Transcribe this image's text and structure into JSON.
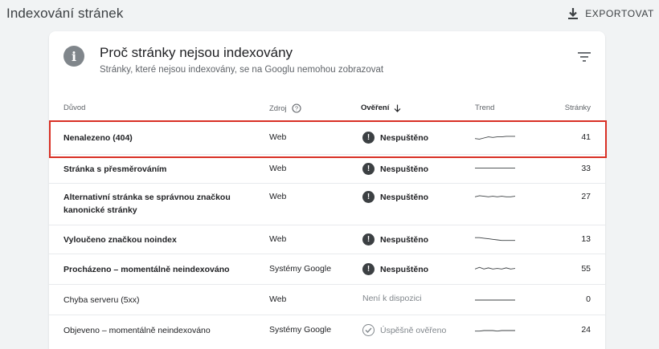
{
  "page": {
    "title": "Indexování stránek",
    "export_label": "EXPORTOVAT"
  },
  "card": {
    "title": "Proč stránky nejsou indexovány",
    "subtitle": "Stránky, které nejsou indexovány, se na Googlu nemohou zobrazovat"
  },
  "table": {
    "headers": {
      "reason": "Důvod",
      "source": "Zdroj",
      "verification": "Ověření",
      "trend": "Trend",
      "pages": "Stránky"
    },
    "rows": [
      {
        "reason": "Nenalezeno (404)",
        "source": "Web",
        "verification": "Nespuštěno",
        "status": "warn",
        "pages": "41",
        "trend": [
          0.55,
          0.6,
          0.5,
          0.4,
          0.45,
          0.4,
          0.4,
          0.35,
          0.35,
          0.35
        ],
        "bold": true
      },
      {
        "reason": "Stránka s přesměrováním",
        "source": "Web",
        "verification": "Nespuštěno",
        "status": "warn",
        "pages": "33",
        "trend": [
          0.4,
          0.4,
          0.4,
          0.4,
          0.4,
          0.4,
          0.4,
          0.4,
          0.4,
          0.4
        ],
        "bold": true
      },
      {
        "reason": "Alternativní stránka se správnou značkou kanonické stránky",
        "source": "Web",
        "verification": "Nespuštěno",
        "status": "warn",
        "pages": "27",
        "trend": [
          0.45,
          0.35,
          0.4,
          0.45,
          0.4,
          0.45,
          0.4,
          0.45,
          0.45,
          0.4
        ],
        "bold": true
      },
      {
        "reason": "Vyloučeno značkou noindex",
        "source": "Web",
        "verification": "Nespuštěno",
        "status": "warn",
        "pages": "13",
        "trend": [
          0.3,
          0.3,
          0.35,
          0.4,
          0.45,
          0.5,
          0.55,
          0.55,
          0.55,
          0.55
        ],
        "bold": true
      },
      {
        "reason": "Procházeno – momentálně neindexováno",
        "source": "Systémy Google",
        "verification": "Nespuštěno",
        "status": "warn",
        "pages": "55",
        "trend": [
          0.45,
          0.3,
          0.45,
          0.35,
          0.45,
          0.4,
          0.45,
          0.35,
          0.45,
          0.4
        ],
        "bold": true
      },
      {
        "reason": "Chyba serveru (5xx)",
        "source": "Web",
        "verification": "Není k dispozici",
        "status": "na",
        "pages": "0",
        "trend": [
          0.5,
          0.5,
          0.5,
          0.5,
          0.5,
          0.5,
          0.5,
          0.5,
          0.5,
          0.5
        ],
        "bold": false
      },
      {
        "reason": "Objeveno – momentálně neindexováno",
        "source": "Systémy Google",
        "verification": "Úspěšně ověřeno",
        "status": "ok",
        "pages": "24",
        "trend": [
          0.55,
          0.55,
          0.5,
          0.5,
          0.5,
          0.55,
          0.5,
          0.5,
          0.5,
          0.5
        ],
        "bold": false
      }
    ]
  },
  "colors": {
    "highlight": "#d93025",
    "icon_gray": "#80868b",
    "warn_icon": "#3c4043"
  },
  "icons": {
    "export": "download-icon",
    "info": "info-icon",
    "filter": "filter-icon",
    "help": "help-icon",
    "sort": "arrow-down-icon",
    "warn": "exclamation-icon",
    "ok": "check-circle-icon"
  }
}
